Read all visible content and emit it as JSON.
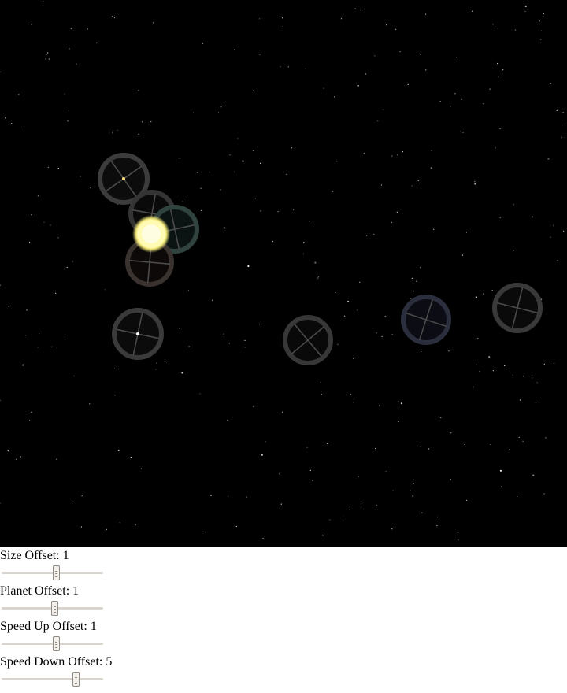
{
  "scene": {
    "colors": {
      "background": "#000000",
      "sun": "#fffbb5",
      "orbit_ring": "#3a3a3a"
    },
    "bodies": [
      {
        "name": "sun-icon"
      },
      {
        "name": "planet-marker-1"
      },
      {
        "name": "planet-marker-2"
      },
      {
        "name": "planet-marker-3"
      },
      {
        "name": "planet-marker-4"
      },
      {
        "name": "planet-marker-5"
      },
      {
        "name": "planet-marker-6"
      },
      {
        "name": "planet-marker-7"
      },
      {
        "name": "planet-marker-8"
      }
    ]
  },
  "controls": [
    {
      "label": "Size Offset:",
      "value": "1",
      "level": 0.54
    },
    {
      "label": "Planet Offset:",
      "value": "1",
      "level": 0.53
    },
    {
      "label": "Speed Up Offset:",
      "value": "1",
      "level": 0.54
    },
    {
      "label": "Speed Down Offset:",
      "value": "5",
      "level": 0.74
    }
  ]
}
